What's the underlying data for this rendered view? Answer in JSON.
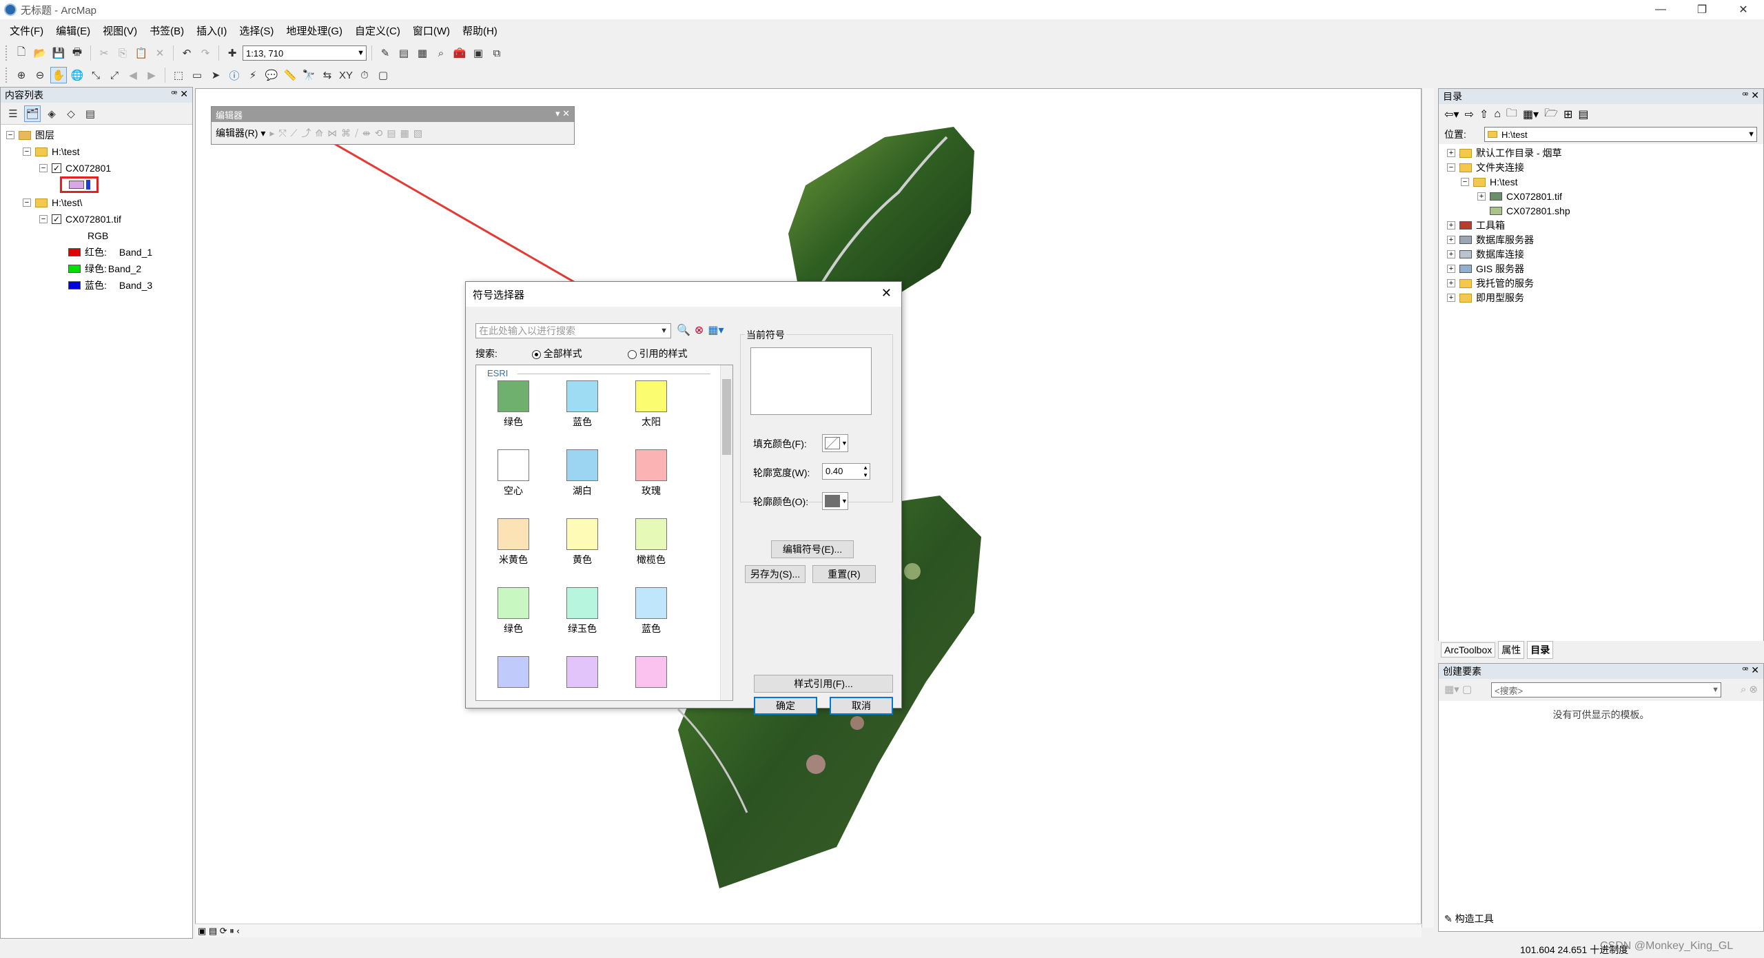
{
  "window": {
    "title": "无标题 - ArcMap",
    "min": "—",
    "max": "❐",
    "close": "✕"
  },
  "menu": [
    "文件(F)",
    "编辑(E)",
    "视图(V)",
    "书签(B)",
    "插入(I)",
    "选择(S)",
    "地理处理(G)",
    "自定义(C)",
    "窗口(W)",
    "帮助(H)"
  ],
  "toolbar": {
    "scale": "1:13, 710"
  },
  "toc": {
    "title": "内容列表",
    "root": "图层",
    "group1": "H:\\test",
    "layer1": "CX072801",
    "group2": "H:\\test\\",
    "layer2": "CX072801.tif",
    "rgb": "RGB",
    "bands": [
      {
        "label": "红色:",
        "band": "Band_1",
        "color": "#e00000"
      },
      {
        "label": "绿色:",
        "band": "Band_2",
        "color": "#00dd00"
      },
      {
        "label": "蓝色:",
        "band": "Band_3",
        "color": "#0000e0"
      }
    ]
  },
  "editor": {
    "title": "编辑器",
    "menu": "编辑器(R) ▾"
  },
  "symbol_dialog": {
    "title": "符号选择器",
    "search_placeholder": "在此处输入以进行搜索",
    "search_label": "搜索:",
    "radio_all": "全部样式",
    "radio_ref": "引用的样式",
    "group_label": "ESRI",
    "symbols": [
      {
        "name": "绿色",
        "color": "#6fb06f"
      },
      {
        "name": "蓝色",
        "color": "#9ddcf2"
      },
      {
        "name": "太阳",
        "color": "#fcfc70"
      },
      {
        "name": "空心",
        "color": "#ffffff"
      },
      {
        "name": "湖白",
        "color": "#9cd5f2"
      },
      {
        "name": "玫瑰",
        "color": "#fbb3b3"
      },
      {
        "name": "米黄色",
        "color": "#fce3b6"
      },
      {
        "name": "黄色",
        "color": "#fdfbb5"
      },
      {
        "name": "橄榄色",
        "color": "#e6f9b7"
      },
      {
        "name": "绿色",
        "color": "#c9f7c2"
      },
      {
        "name": "绿玉色",
        "color": "#b7f5de"
      },
      {
        "name": "蓝色",
        "color": "#bfe6fb"
      },
      {
        "name": "",
        "color": "#c0cafb"
      },
      {
        "name": "",
        "color": "#e2c4fb"
      },
      {
        "name": "",
        "color": "#f9c2ef"
      }
    ],
    "current_symbol": "当前符号",
    "fill_color": "填充颜色(F):",
    "outline_width": "轮廓宽度(W):",
    "outline_width_value": "0.40",
    "outline_color": "轮廓颜色(O):",
    "edit_symbol": "编辑符号(E)...",
    "save_as": "另存为(S)...",
    "reset": "重置(R)",
    "style_ref": "样式引用(F)...",
    "ok": "确定",
    "cancel": "取消"
  },
  "catalog": {
    "title": "目录",
    "location_label": "位置:",
    "location_value": "H:\\test",
    "items": [
      {
        "label": "默认工作目录 - 烟草"
      },
      {
        "label": "文件夹连接"
      },
      {
        "label": "H:\\test"
      },
      {
        "label": "CX072801.tif"
      },
      {
        "label": "CX072801.shp"
      },
      {
        "label": "工具箱"
      },
      {
        "label": "数据库服务器"
      },
      {
        "label": "数据库连接"
      },
      {
        "label": "GIS 服务器"
      },
      {
        "label": "我托管的服务"
      },
      {
        "label": "即用型服务"
      }
    ],
    "tabs": [
      "ArcToolbox",
      "属性",
      "目录"
    ]
  },
  "create_features": {
    "title": "创建要素",
    "search_placeholder": "<搜索>",
    "empty_msg": "没有可供显示的模板。",
    "construct_tools": "构造工具"
  },
  "status": {
    "coords": "101.604  24.651 十进制度",
    "watermark": "CSDN @Monkey_King_GL"
  }
}
